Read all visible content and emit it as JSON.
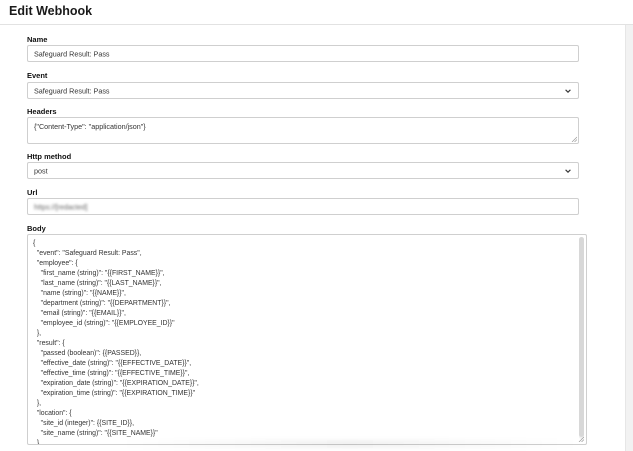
{
  "page": {
    "title": "Edit Webhook"
  },
  "form": {
    "name": {
      "label": "Name",
      "value": "Safeguard Result: Pass"
    },
    "event": {
      "label": "Event",
      "value": "Safeguard Result: Pass"
    },
    "headers": {
      "label": "Headers",
      "value": "{\"Content-Type\": \"application/json\"}"
    },
    "http_method": {
      "label": "Http method",
      "value": "post"
    },
    "url": {
      "label": "Url",
      "value": "https://[redacted]"
    },
    "body": {
      "label": "Body",
      "value": "{\n  \"event\": \"Safeguard Result: Pass\",\n  \"employee\": {\n    \"first_name (string)\": \"{{FIRST_NAME}}\",\n    \"last_name (string)\": \"{{LAST_NAME}}\",\n    \"name (string)\": \"{{NAME}}\",\n    \"department (string)\": \"{{DEPARTMENT}}\",\n    \"email (string)\": \"{{EMAIL}}\",\n    \"employee_id (string)\": \"{{EMPLOYEE_ID}}\"\n  },\n  \"result\": {\n    \"passed (boolean)\": {{PASSED}},\n    \"effective_date (string)\": \"{{EFFECTIVE_DATE}}\",\n    \"effective_time (string)\": \"{{EFFECTIVE_TIME}}\",\n    \"expiration_date (string)\": \"{{EXPIRATION_DATE}}\",\n    \"expiration_time (string)\": \"{{EXPIRATION_TIME}}\"\n  },\n  \"location\": {\n    \"site_id (integer)\": {{SITE_ID}},\n    \"site_name (string)\": \"{{SITE_NAME}}\"\n  }\n}"
    }
  },
  "icons": {
    "select_chevron": "chevron-down-icon",
    "resize": "resize-grip-icon"
  },
  "colors": {
    "border": "#cfcfcf",
    "background": "#f2f2f2",
    "panel": "#ffffff"
  }
}
